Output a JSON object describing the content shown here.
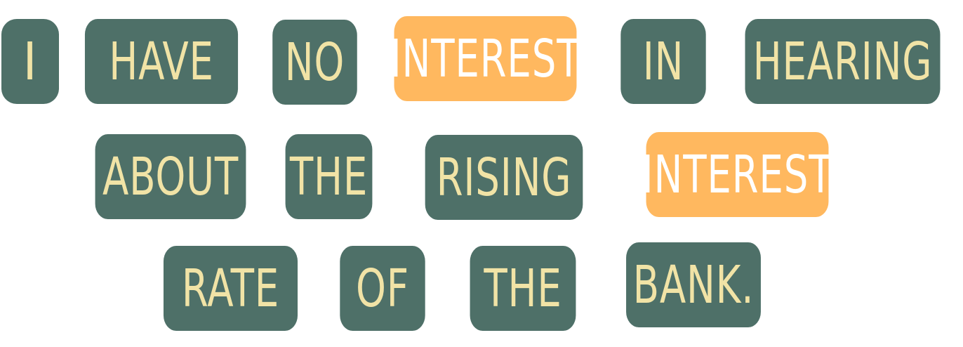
{
  "sentence": {
    "words": [
      {
        "text": "I",
        "highlight": false
      },
      {
        "text": "HAVE",
        "highlight": false
      },
      {
        "text": "NO",
        "highlight": false
      },
      {
        "text": "INTEREST",
        "highlight": true
      },
      {
        "text": "IN",
        "highlight": false
      },
      {
        "text": "HEARING",
        "highlight": false
      },
      {
        "text": "ABOUT",
        "highlight": false
      },
      {
        "text": "THE",
        "highlight": false
      },
      {
        "text": "RISING",
        "highlight": false
      },
      {
        "text": "INTEREST",
        "highlight": true
      },
      {
        "text": "RATE",
        "highlight": false
      },
      {
        "text": "OF",
        "highlight": false
      },
      {
        "text": "THE",
        "highlight": false
      },
      {
        "text": "BANK.",
        "highlight": false
      }
    ]
  },
  "colors": {
    "tile": "#4e7068",
    "tile_text": "#f1e3a6",
    "highlight_tile": "#ffb85f",
    "highlight_text": "#ffffff",
    "background": "#ffffff"
  }
}
